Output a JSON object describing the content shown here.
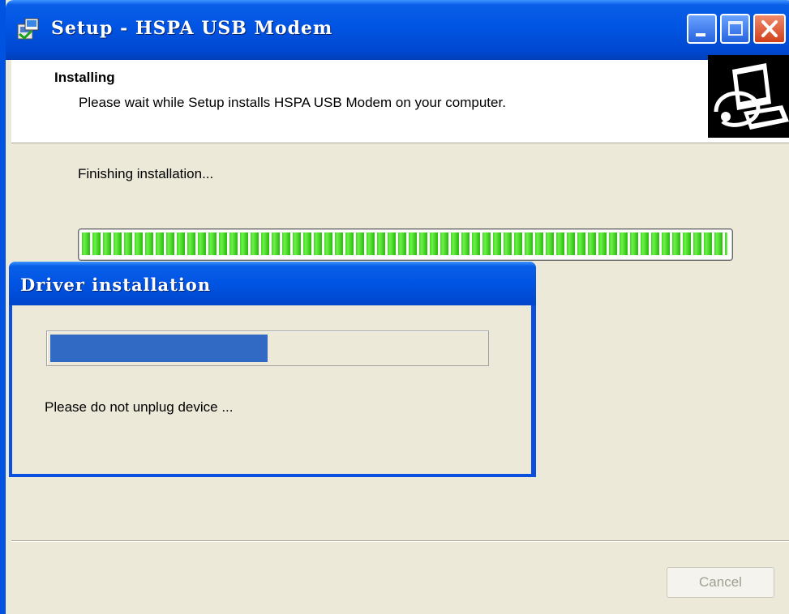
{
  "window": {
    "title": "Setup - HSPA USB Modem",
    "controls": {
      "minimize": "minimize",
      "maximize": "maximize",
      "close": "close"
    }
  },
  "header": {
    "title": "Installing",
    "subtitle": "Please wait while Setup installs HSPA USB Modem on your computer."
  },
  "main": {
    "status_text": "Finishing installation...",
    "progress_fraction": 1.0
  },
  "popup": {
    "title": "Driver installation",
    "progress_fraction": 0.5,
    "message": "Please do not unplug device ..."
  },
  "footer": {
    "cancel_label": "Cancel",
    "cancel_enabled": false
  },
  "colors": {
    "titlebar_blue": "#0054e3",
    "progress_green": "#40d820",
    "driver_progress_blue": "#316ac5",
    "dialog_background": "#ece9d8"
  },
  "icons": [
    "setup-app-icon",
    "minimize-icon",
    "maximize-icon",
    "close-icon",
    "computer-setup-icon"
  ]
}
